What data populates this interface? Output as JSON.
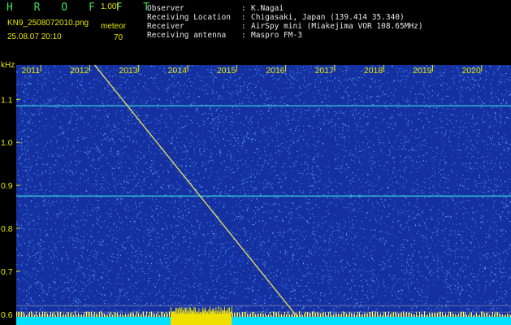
{
  "header": {
    "app_logo": "H R O F F T",
    "version": "1.00f",
    "file_name": "KN9_2508072010.png",
    "timestamp": "25.08.07 20:10",
    "meteor_label": "meteor",
    "meteor_count": "70"
  },
  "info": [
    {
      "key": "Observer",
      "sep": ":",
      "value": "K.Nagai"
    },
    {
      "key": "Receiving Location",
      "sep": ":",
      "value": "Chigasaki, Japan (139.414 35.340)"
    },
    {
      "key": "Receiver",
      "sep": ":",
      "value": "AirSpy mini (Miakejima VOR 108.65MHz)"
    },
    {
      "key": "Receiving antenna",
      "sep": ":",
      "value": "Maspro FM-3"
    }
  ],
  "colors": {
    "background": "#1530a0",
    "noise_dot": "#3a8cff",
    "carrier_line": "#38c8d8",
    "trace_line": "#e0d860",
    "baseline": "#00e0ff",
    "burst": "#f0e000",
    "axis_text": "#e6e600"
  },
  "chart_data": {
    "type": "heatmap",
    "title": "",
    "xlabel": "",
    "ylabel": "kHz",
    "x_ticks": [
      "2011",
      "2012",
      "2013",
      "2014",
      "2015",
      "2016",
      "2017",
      "2018",
      "2019",
      "2020"
    ],
    "y_ticks": [
      "1.1",
      "1.0",
      "0.9",
      "0.8",
      "0.7",
      "0.6"
    ],
    "x_range": [
      2010.5,
      2020.6
    ],
    "y_range": [
      0.575,
      1.18
    ],
    "carriers_khz": [
      1.085,
      0.875
    ],
    "reference_lines_khz": [
      0.62,
      0.605
    ],
    "trace": {
      "start": [
        2012.1,
        1.18
      ],
      "end": [
        2016.3,
        0.585
      ]
    }
  }
}
